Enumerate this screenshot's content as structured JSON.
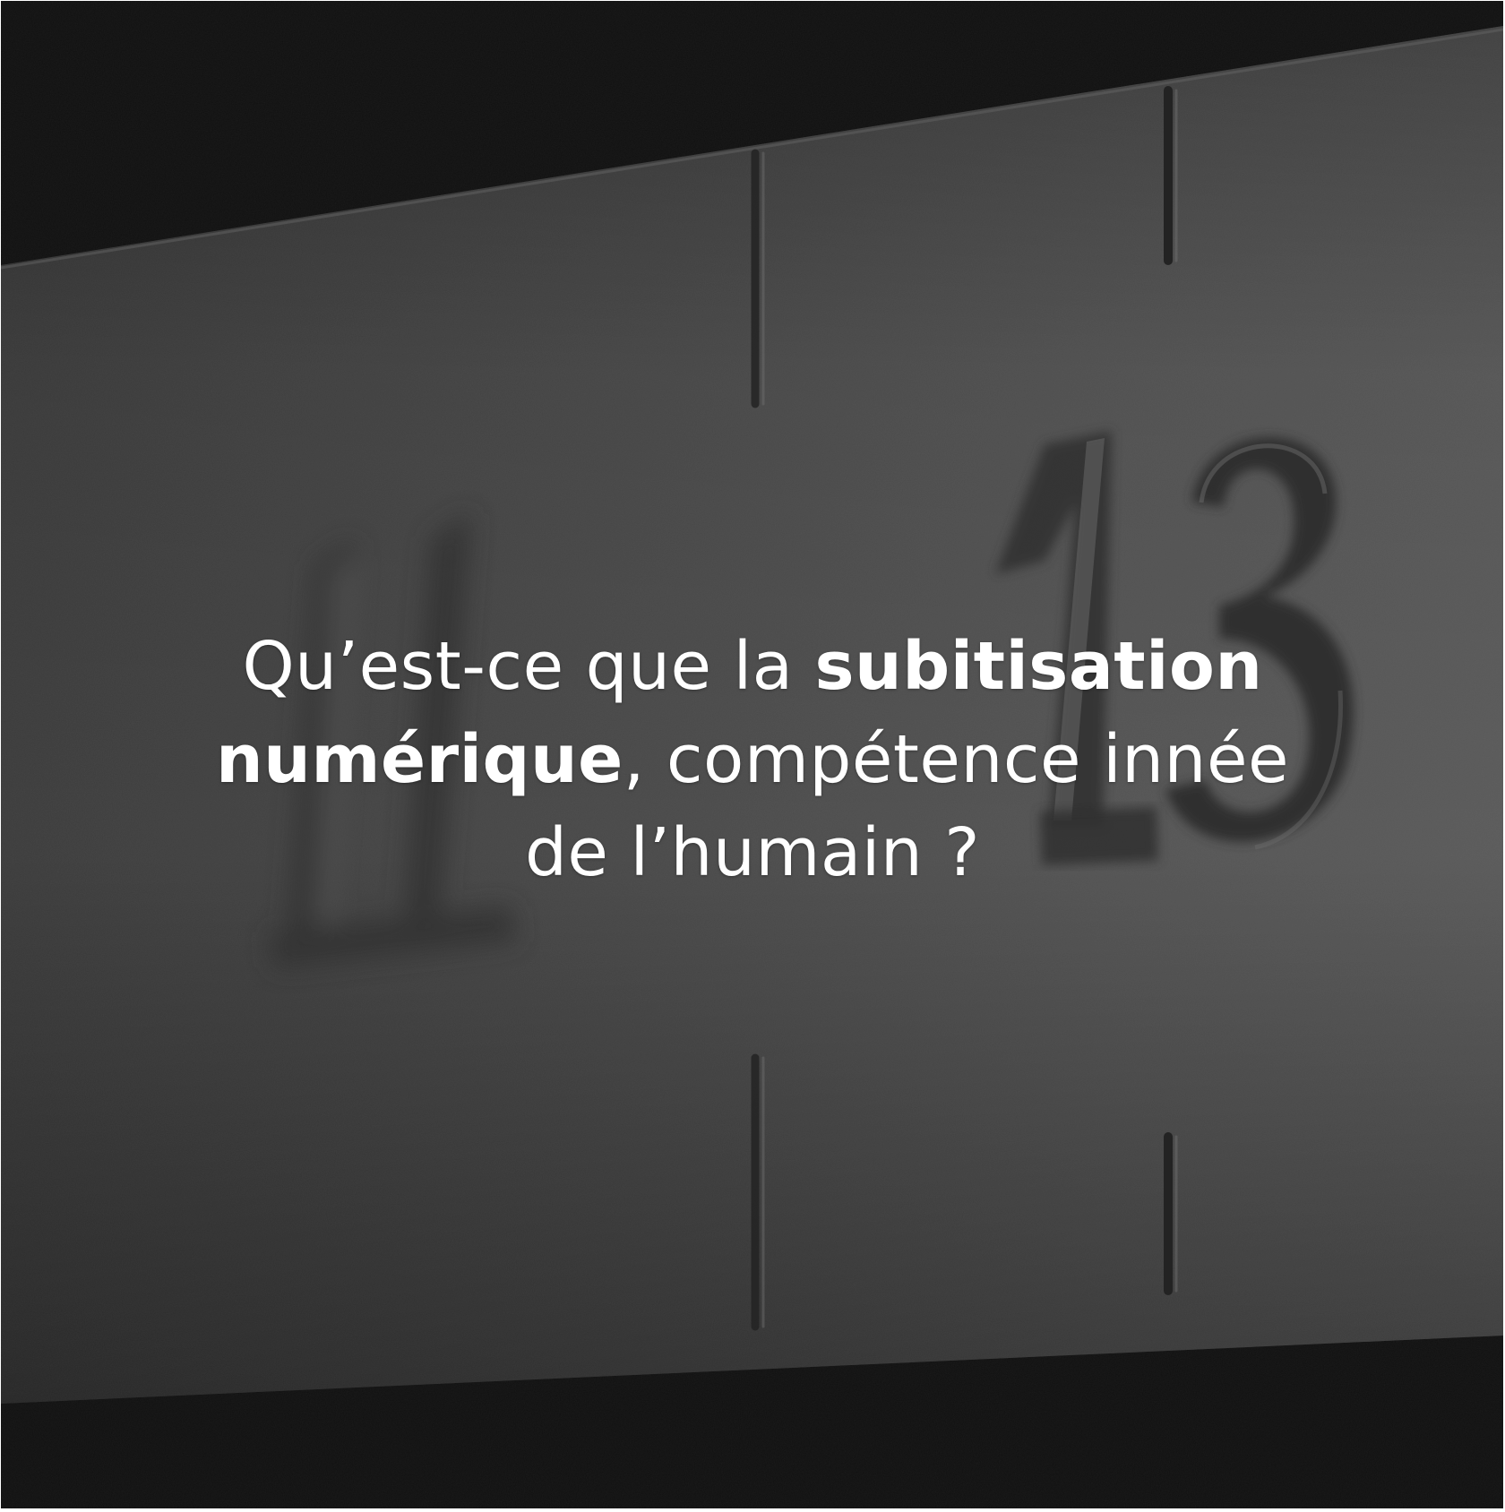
{
  "caption": {
    "line1_regular": "Qu’est-ce que la ",
    "line1_bold": "subitisation",
    "line2_bold": "numérique",
    "line2_regular": ", compétence innée",
    "line3_regular": "de l’humain ?"
  },
  "photo": {
    "description_tags": [
      "engraved-numeral-11",
      "engraved-numeral-13",
      "stone-ruler"
    ],
    "numerals": [
      "11",
      "13"
    ],
    "colors": {
      "stone": "#5a5a5a",
      "stone_light": "#6e6e6e",
      "shadow": "#141414",
      "text": "#ffffff"
    }
  }
}
